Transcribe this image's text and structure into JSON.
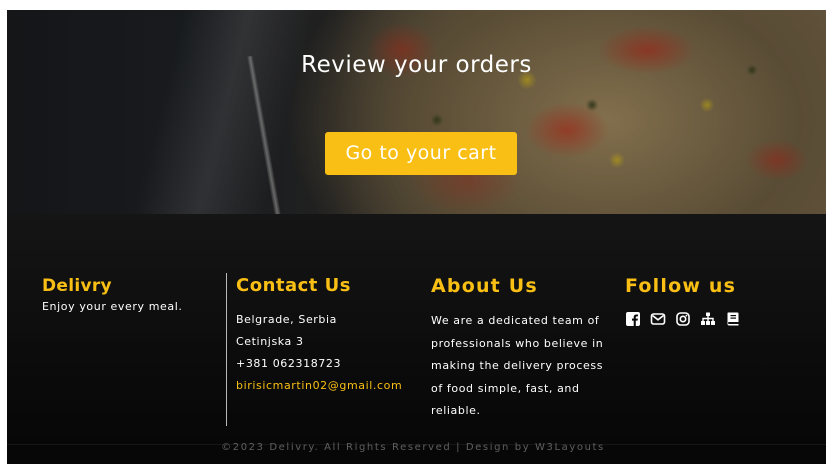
{
  "hero": {
    "title": "Review your orders",
    "cart_button": "Go to your cart"
  },
  "footer": {
    "brand": {
      "name": "Delivry",
      "tagline": "Enjoy your every meal."
    },
    "contact": {
      "heading": "Contact Us",
      "lines": [
        "Belgrade, Serbia",
        "Cetinjska 3",
        "+381 062318723"
      ],
      "email": "birisicmartin02@gmail.com"
    },
    "about": {
      "heading": "About Us",
      "text": "We are a dedicated team of professionals who believe in making the delivery process of food simple, fast, and reliable."
    },
    "follow": {
      "heading": "Follow us",
      "icons": [
        "facebook-icon",
        "email-icon",
        "instagram-icon",
        "sitemap-icon",
        "book-icon"
      ]
    },
    "copyright": "©2023 Delivry. All Rights Reserved | Design by W3Layouts"
  },
  "colors": {
    "accent": "#f9bf14",
    "footer_bg": "#0b0b0b",
    "text": "#ffffff"
  }
}
